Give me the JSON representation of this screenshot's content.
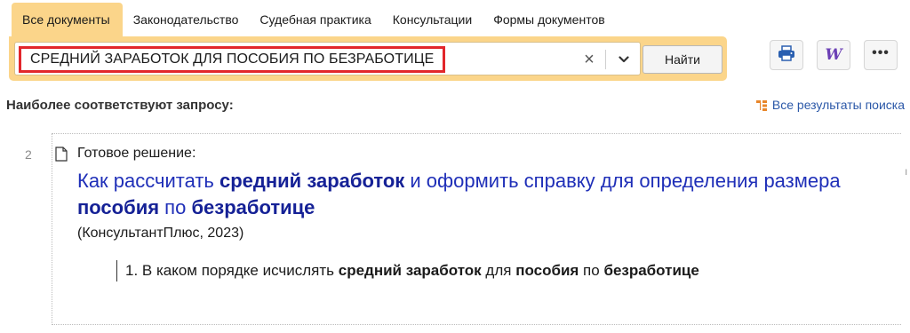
{
  "tabs": [
    {
      "label": "Все документы",
      "active": true
    },
    {
      "label": "Законодательство",
      "active": false
    },
    {
      "label": "Судебная практика",
      "active": false
    },
    {
      "label": "Консультации",
      "active": false
    },
    {
      "label": "Формы документов",
      "active": false
    }
  ],
  "search": {
    "value": "СРЕДНИЙ ЗАРАБОТОК ДЛЯ ПОСОБИЯ ПО БЕЗРАБОТИЦЕ",
    "clear_icon": "×",
    "find_label": "Найти"
  },
  "toolbar": {
    "word_glyph": "W",
    "more_glyph": "•••"
  },
  "header": {
    "section_title": "Наиболее соответствуют запросу:",
    "all_results_label": "Все результаты поиска"
  },
  "result": {
    "number": "2",
    "type_label": "Готовое решение:",
    "title_parts": [
      {
        "text": "Как рассчитать ",
        "bold": false
      },
      {
        "text": "средний заработок",
        "bold": true
      },
      {
        "text": " и оформить справку для определения размера ",
        "bold": false
      },
      {
        "text": "пособия",
        "bold": true
      },
      {
        "text": " по ",
        "bold": false
      },
      {
        "text": "безработице",
        "bold": true
      }
    ],
    "source": "(КонсультантПлюс, 2023)",
    "snippet_parts": [
      {
        "text": "1. В каком порядке исчислять ",
        "bold": false
      },
      {
        "text": "средний заработок",
        "bold": true
      },
      {
        "text": " для ",
        "bold": false
      },
      {
        "text": "пособия",
        "bold": true
      },
      {
        "text": " по ",
        "bold": false
      },
      {
        "text": "безработице",
        "bold": true
      }
    ],
    "right_mark": "ı"
  },
  "colors": {
    "tab_active": "#fbd58a",
    "search_highlight": "#e2262b",
    "link": "#1f2fb8",
    "word_icon": "#6b3fb5",
    "print_icon": "#2a5fb0",
    "results_icon": "#e8862a"
  },
  "icons": {
    "clear": "close-icon",
    "dropdown": "chevron-down-icon",
    "print": "printer-icon",
    "word": "word-icon",
    "more": "more-icon",
    "results": "results-tree-icon",
    "document": "document-icon"
  }
}
